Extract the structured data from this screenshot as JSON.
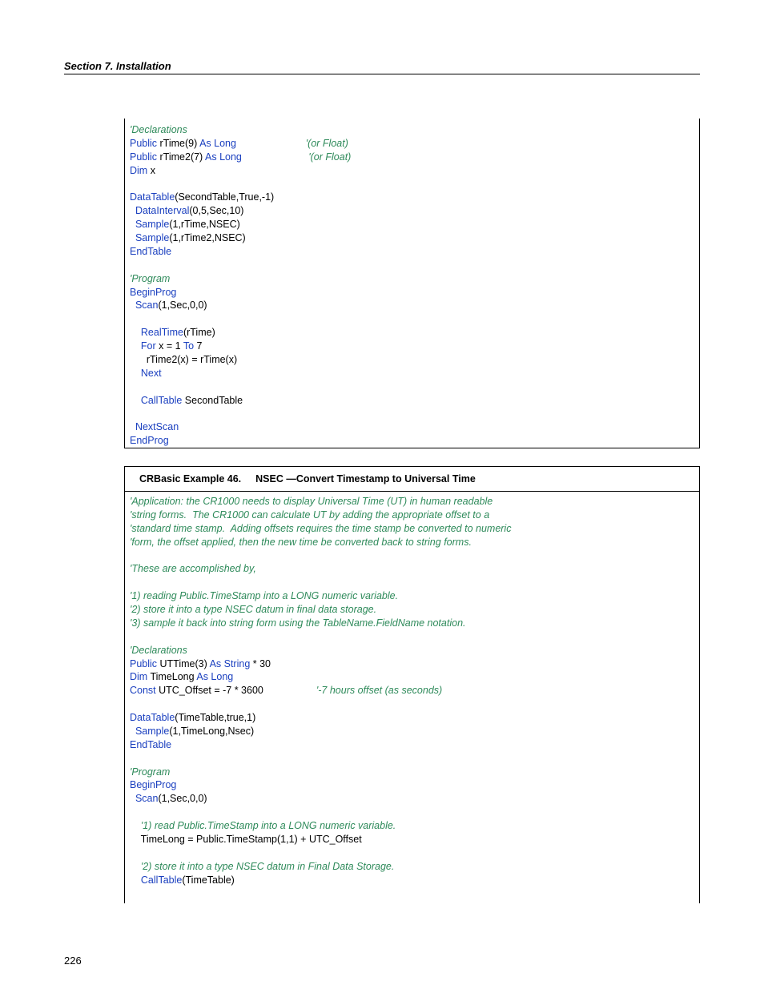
{
  "header": "Section 7.  Installation",
  "pageNumber": "226",
  "box1": {
    "lines": [
      [
        {
          "t": "'Declarations",
          "c": "cm"
        }
      ],
      [
        {
          "t": "Public",
          "c": "kw"
        },
        {
          "t": " rTime(9) "
        },
        {
          "t": "As Long",
          "c": "kw"
        },
        {
          "t": "                         "
        },
        {
          "t": "'(or Float)",
          "c": "cm"
        }
      ],
      [
        {
          "t": "Public",
          "c": "kw"
        },
        {
          "t": " rTime2(7) "
        },
        {
          "t": "As Long",
          "c": "kw"
        },
        {
          "t": "                        "
        },
        {
          "t": "'(or Float)",
          "c": "cm"
        }
      ],
      [
        {
          "t": "Dim",
          "c": "kw"
        },
        {
          "t": " x"
        }
      ],
      [
        {
          "t": ""
        }
      ],
      [
        {
          "t": "DataTable",
          "c": "kw"
        },
        {
          "t": "(SecondTable,True,-1)"
        }
      ],
      [
        {
          "t": "  "
        },
        {
          "t": "DataInterval",
          "c": "kw"
        },
        {
          "t": "(0,5,Sec,10)"
        }
      ],
      [
        {
          "t": "  "
        },
        {
          "t": "Sample",
          "c": "kw"
        },
        {
          "t": "(1,rTime,NSEC)"
        }
      ],
      [
        {
          "t": "  "
        },
        {
          "t": "Sample",
          "c": "kw"
        },
        {
          "t": "(1,rTime2,NSEC)"
        }
      ],
      [
        {
          "t": "EndTable",
          "c": "kw"
        }
      ],
      [
        {
          "t": ""
        }
      ],
      [
        {
          "t": "'Program",
          "c": "cm"
        }
      ],
      [
        {
          "t": "BeginProg",
          "c": "kw"
        }
      ],
      [
        {
          "t": "  "
        },
        {
          "t": "Scan",
          "c": "kw"
        },
        {
          "t": "(1,Sec,0,0)"
        }
      ],
      [
        {
          "t": ""
        }
      ],
      [
        {
          "t": "    "
        },
        {
          "t": "RealTime",
          "c": "kw"
        },
        {
          "t": "(rTime)"
        }
      ],
      [
        {
          "t": "    "
        },
        {
          "t": "For",
          "c": "kw"
        },
        {
          "t": " x = 1 "
        },
        {
          "t": "To",
          "c": "kw"
        },
        {
          "t": " 7"
        }
      ],
      [
        {
          "t": "      rTime2(x) = rTime(x)"
        }
      ],
      [
        {
          "t": "    "
        },
        {
          "t": "Next",
          "c": "kw"
        }
      ],
      [
        {
          "t": ""
        }
      ],
      [
        {
          "t": "    "
        },
        {
          "t": "CallTable",
          "c": "kw"
        },
        {
          "t": " SecondTable"
        }
      ],
      [
        {
          "t": ""
        }
      ],
      [
        {
          "t": "  "
        },
        {
          "t": "NextScan",
          "c": "kw"
        }
      ],
      [
        {
          "t": "EndProg",
          "c": "kw"
        }
      ]
    ]
  },
  "box2": {
    "titlePrefix": "CRBasic Example 46.",
    "titleRest": "NSEC —Convert Timestamp to Universal Time",
    "lines": [
      [
        {
          "t": "'Application: the CR1000 needs to display Universal Time (UT) in human readable",
          "c": "cm"
        }
      ],
      [
        {
          "t": "'string forms.  The CR1000 can calculate UT by adding the appropriate offset to a",
          "c": "cm"
        }
      ],
      [
        {
          "t": "'standard time stamp.  Adding offsets requires the time stamp be converted to numeric",
          "c": "cm"
        }
      ],
      [
        {
          "t": "'form, the offset applied, then the new time be converted back to string forms.",
          "c": "cm"
        }
      ],
      [
        {
          "t": ""
        }
      ],
      [
        {
          "t": "'These are accomplished by,",
          "c": "cm"
        }
      ],
      [
        {
          "t": ""
        }
      ],
      [
        {
          "t": "'1) reading Public.TimeStamp into a LONG numeric variable.",
          "c": "cm"
        }
      ],
      [
        {
          "t": "'2) store it into a type NSEC datum in final data storage.",
          "c": "cm"
        }
      ],
      [
        {
          "t": "'3) sample it back into string form using the TableName.FieldName notation.",
          "c": "cm"
        }
      ],
      [
        {
          "t": ""
        }
      ],
      [
        {
          "t": "'Declarations",
          "c": "cm"
        }
      ],
      [
        {
          "t": "Public",
          "c": "kw"
        },
        {
          "t": " UTTime(3) "
        },
        {
          "t": "As String",
          "c": "kw"
        },
        {
          "t": " * 30"
        }
      ],
      [
        {
          "t": "Dim",
          "c": "kw"
        },
        {
          "t": " TimeLong "
        },
        {
          "t": "As Long",
          "c": "kw"
        }
      ],
      [
        {
          "t": "Const",
          "c": "kw"
        },
        {
          "t": " UTC_Offset = -7 * 3600                   "
        },
        {
          "t": "'-7 hours offset (as seconds)",
          "c": "cm"
        }
      ],
      [
        {
          "t": ""
        }
      ],
      [
        {
          "t": "DataTable",
          "c": "kw"
        },
        {
          "t": "(TimeTable,true,1)"
        }
      ],
      [
        {
          "t": "  "
        },
        {
          "t": "Sample",
          "c": "kw"
        },
        {
          "t": "(1,TimeLong,Nsec)"
        }
      ],
      [
        {
          "t": "EndTable",
          "c": "kw"
        }
      ],
      [
        {
          "t": ""
        }
      ],
      [
        {
          "t": "'Program",
          "c": "cm"
        }
      ],
      [
        {
          "t": "BeginProg",
          "c": "kw"
        }
      ],
      [
        {
          "t": "  "
        },
        {
          "t": "Scan",
          "c": "kw"
        },
        {
          "t": "(1,Sec,0,0)"
        }
      ],
      [
        {
          "t": ""
        }
      ],
      [
        {
          "t": "    "
        },
        {
          "t": "'1) read Public.TimeStamp into a LONG numeric variable.",
          "c": "cm"
        }
      ],
      [
        {
          "t": "    TimeLong = Public.TimeStamp(1,1) + UTC_Offset"
        }
      ],
      [
        {
          "t": ""
        }
      ],
      [
        {
          "t": "    "
        },
        {
          "t": "'2) store it into a type NSEC datum in Final Data Storage.",
          "c": "cm"
        }
      ],
      [
        {
          "t": "    "
        },
        {
          "t": "CallTable",
          "c": "kw"
        },
        {
          "t": "(TimeTable)"
        }
      ],
      [
        {
          "t": ""
        }
      ]
    ]
  }
}
